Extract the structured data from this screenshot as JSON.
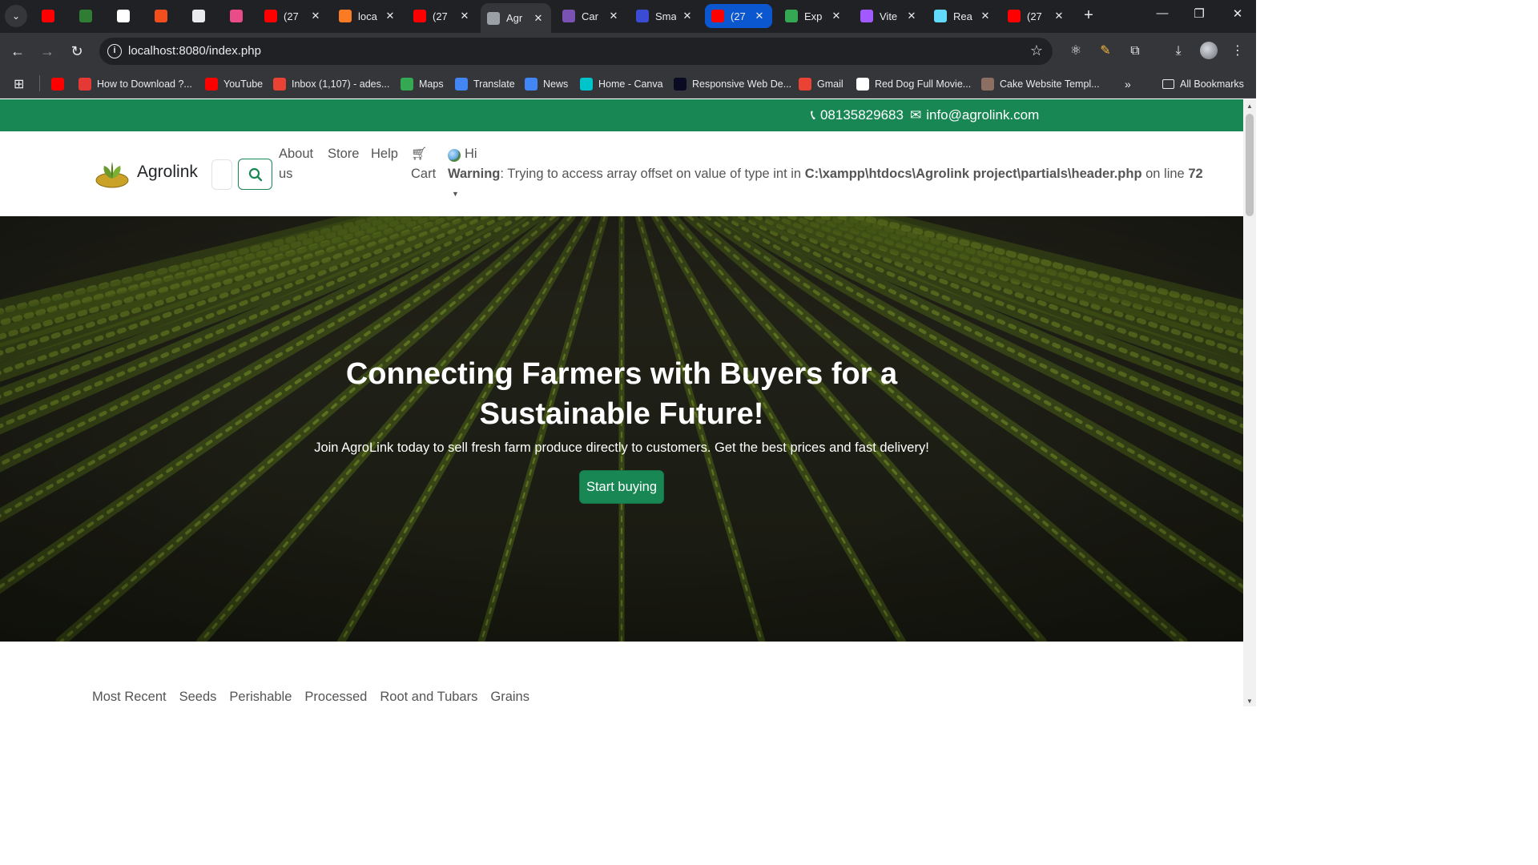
{
  "browser": {
    "tabs": [
      {
        "title": "",
        "favicon": "youtube-icon",
        "color": "#ff0000"
      },
      {
        "title": "",
        "favicon": "leaf-icon",
        "color": "#2e7d32"
      },
      {
        "title": "",
        "favicon": "openai-icon",
        "color": "#ffffff"
      },
      {
        "title": "",
        "favicon": "figma-icon",
        "color": "#f24e1e"
      },
      {
        "title": "",
        "favicon": "rocket-icon",
        "color": "#e8eaed"
      },
      {
        "title": "",
        "favicon": "dribbble-icon",
        "color": "#ea4c89"
      },
      {
        "title": "(27",
        "favicon": "youtube-icon",
        "color": "#ff0000"
      },
      {
        "title": "loca",
        "favicon": "xampp-icon",
        "color": "#fb7a24"
      },
      {
        "title": "(27",
        "favicon": "youtube-icon",
        "color": "#ff0000"
      },
      {
        "title": "Agr",
        "favicon": "globe-icon",
        "color": "#9aa0a6",
        "active": true
      },
      {
        "title": "Car",
        "favicon": "bootstrap-icon",
        "color": "#7952b3"
      },
      {
        "title": "Sma",
        "favicon": "location-icon",
        "color": "#3c4bd6"
      },
      {
        "title": "(27",
        "favicon": "youtube-icon",
        "color": "#ff0000",
        "highlighted": true
      },
      {
        "title": "Exp",
        "favicon": "sheets-icon",
        "color": "#34a853"
      },
      {
        "title": "Vite",
        "favicon": "vite-icon",
        "color": "#a259ff"
      },
      {
        "title": "Rea",
        "favicon": "react-icon",
        "color": "#61dafb"
      },
      {
        "title": "(27",
        "favicon": "youtube-icon",
        "color": "#ff0000"
      }
    ],
    "url": "localhost:8080/index.php",
    "bookmarks": [
      {
        "label": "",
        "icon": "youtube-icon",
        "color": "#ff0000"
      },
      {
        "label": "How to Download ?...",
        "icon": "ig-icon",
        "color": "#e53935"
      },
      {
        "label": "YouTube",
        "icon": "youtube-icon",
        "color": "#ff0000"
      },
      {
        "label": "Inbox (1,107) - ades...",
        "icon": "gmail-icon",
        "color": "#ea4335"
      },
      {
        "label": "Maps",
        "icon": "maps-icon",
        "color": "#34a853"
      },
      {
        "label": "Translate",
        "icon": "translate-icon",
        "color": "#4285f4"
      },
      {
        "label": "News",
        "icon": "news-icon",
        "color": "#4285f4"
      },
      {
        "label": "Home - Canva",
        "icon": "canva-icon",
        "color": "#00c4cc"
      },
      {
        "label": "Responsive Web De...",
        "icon": "fcc-icon",
        "color": "#0a0a23"
      },
      {
        "label": "Gmail",
        "icon": "gmail-icon",
        "color": "#ea4335"
      },
      {
        "label": "Red Dog Full Movie...",
        "icon": "page-icon",
        "color": "#ffffff"
      },
      {
        "label": "Cake Website Templ...",
        "icon": "cake-icon",
        "color": "#8d6e63"
      }
    ],
    "all_bookmarks": "All Bookmarks"
  },
  "site": {
    "phone": "08135829683",
    "email": "info@agrolink.com",
    "brand": "Agrolink",
    "nav": {
      "about_line1": "About",
      "about_line2": "us",
      "store": "Store",
      "help": "Help",
      "cart": "Cart",
      "greeting": "Hi"
    },
    "warning": {
      "label": "Warning",
      "message": ": Trying to access array offset on value of type int in ",
      "path": "C:\\xampp\\htdocs\\Agrolink project\\partials\\header.php",
      "on_line": " on line ",
      "line": "72"
    },
    "hero": {
      "title": "Connecting Farmers with Buyers for a Sustainable Future!",
      "subtitle": "Join AgroLink today to sell fresh farm produce directly to customers. Get the best prices and fast delivery!",
      "cta": "Start buying"
    },
    "categories": [
      "Most Recent",
      "Seeds",
      "Perishable",
      "Processed",
      "Root and Tubars",
      "Grains"
    ]
  },
  "colors": {
    "brand_green": "#198754",
    "chrome_dark": "#202124",
    "chrome_toolbar": "#35363a"
  }
}
